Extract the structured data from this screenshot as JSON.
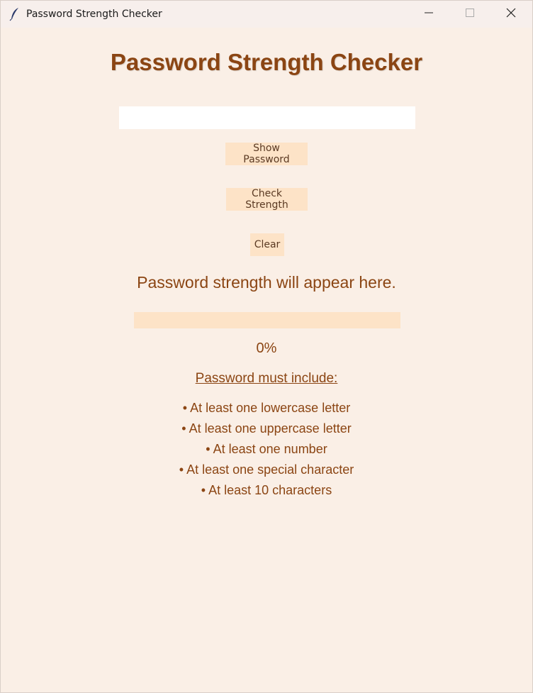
{
  "window": {
    "title": "Password Strength Checker",
    "icon": "feather-icon"
  },
  "heading": "Password Strength Checker",
  "password_input": {
    "value": "",
    "placeholder": ""
  },
  "buttons": {
    "show_password": "Show Password",
    "check_strength": "Check Strength",
    "clear": "Clear"
  },
  "strength_message": "Password strength will appear here.",
  "progress": {
    "value": 0,
    "label": "0%"
  },
  "requirements": {
    "title": "Password must include:",
    "items": [
      "• At least one lowercase letter",
      "• At least one uppercase letter",
      "• At least one number",
      "• At least one special character",
      "• At least 10 characters"
    ]
  },
  "colors": {
    "background": "#faefe6",
    "accent": "#8b4513",
    "button": "#fde3c7"
  }
}
